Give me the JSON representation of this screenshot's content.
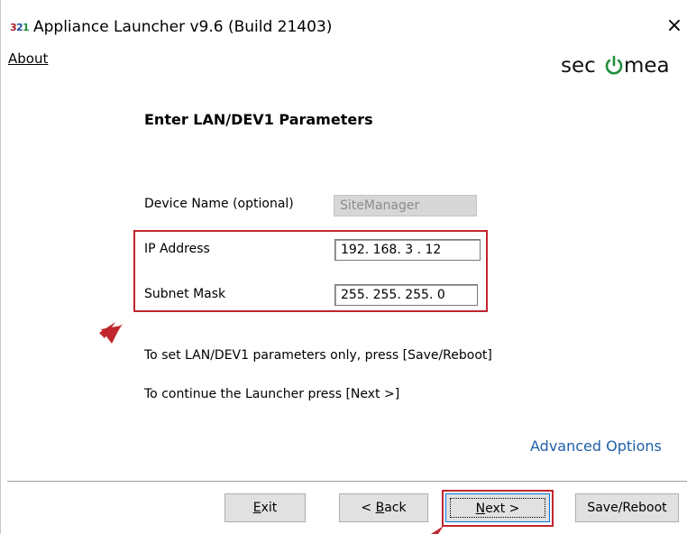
{
  "window": {
    "title": "Appliance Launcher v9.6 (Build 21403)",
    "close_glyph": "×",
    "app_icon": "appliance-launcher-icon"
  },
  "menu": {
    "about_label": "About"
  },
  "brand": {
    "logo_text": "secomea",
    "logo_color": "#000000",
    "accent_color": "#1f8f3a"
  },
  "form": {
    "heading": "Enter LAN/DEV1 Parameters",
    "device_name": {
      "label": "Device Name (optional)",
      "value": "SiteManager",
      "enabled": false
    },
    "ip_address": {
      "label": "IP Address",
      "value": "192. 168.  3  .  12"
    },
    "subnet_mask": {
      "label": "Subnet Mask",
      "value": "255. 255. 255.  0"
    }
  },
  "info": {
    "line1": "To set LAN/DEV1 parameters only, press [Save/Reboot]",
    "line2": "To continue the Launcher press [Next >]"
  },
  "links": {
    "advanced_options": "Advanced Options",
    "advanced_color": "#1f5fa8"
  },
  "buttons": {
    "exit": {
      "mnemonic": "E",
      "rest": "xit"
    },
    "back": {
      "prefix": "< ",
      "mnemonic": "B",
      "rest": "ack"
    },
    "next": {
      "mnemonic": "N",
      "rest": "ext >"
    },
    "save_reboot": "Save/Reboot"
  },
  "annotations": {
    "highlight_color": "#c0262e"
  }
}
